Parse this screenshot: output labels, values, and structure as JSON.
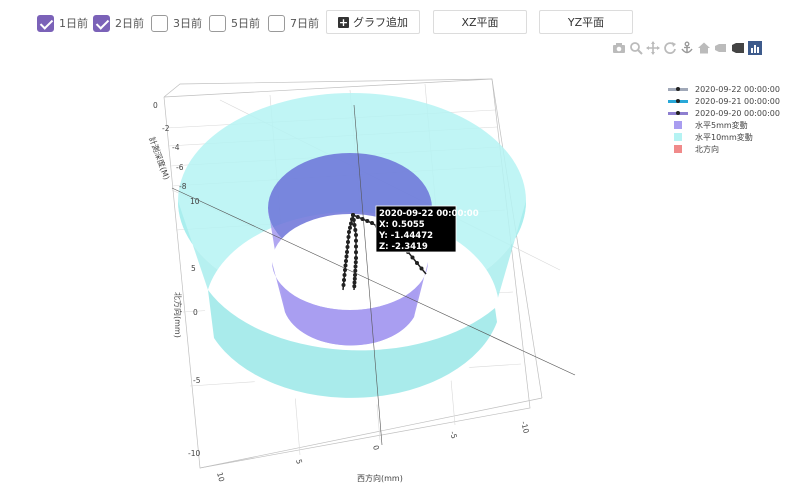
{
  "controls": {
    "checkboxes": [
      {
        "label": "1日前",
        "checked": true
      },
      {
        "label": "2日前",
        "checked": true
      },
      {
        "label": "3日前",
        "checked": false
      },
      {
        "label": "5日前",
        "checked": false
      },
      {
        "label": "7日前",
        "checked": false
      }
    ],
    "add_graph_label": "グラフ追加",
    "xz_plane_label": "XZ平面",
    "yz_plane_label": "YZ平面"
  },
  "modebar_icons": [
    "camera-icon",
    "zoom-icon",
    "pan-icon",
    "orbit-rotation-icon",
    "turntable-rotation-icon",
    "home-icon",
    "hover-closest-icon",
    "toggle-spike-lines-icon",
    "plotly-logo-icon"
  ],
  "legend": [
    {
      "label": "2020-09-22 00:00:00",
      "kind": "line",
      "color": "#a0a8b8"
    },
    {
      "label": "2020-09-21 00:00:00",
      "kind": "line",
      "color": "#29a8d8"
    },
    {
      "label": "2020-09-20 00:00:00",
      "kind": "line",
      "color": "#8e7fd0"
    },
    {
      "label": "水平5mm変動",
      "kind": "square",
      "color": "#a99df0"
    },
    {
      "label": "水平10mm変動",
      "kind": "square",
      "color": "#b5f3f3"
    },
    {
      "label": "北方向",
      "kind": "square",
      "color": "#f08a8a"
    }
  ],
  "tooltip": {
    "title": "2020-09-22 00:00:00",
    "x": "X: 0.5055",
    "y": "Y: -1.44472",
    "z": "Z: -2.3419"
  },
  "chart_data": {
    "type": "scatter3d",
    "axes": {
      "x": {
        "title": "西方向(mm)",
        "ticks": [
          "10",
          "5",
          "0",
          "-5",
          "-10"
        ],
        "range": [
          10,
          -10
        ]
      },
      "y": {
        "title": "北方向(mm)",
        "ticks": [
          "10",
          "5",
          "0",
          "-5",
          "-10"
        ],
        "range": [
          10,
          -10
        ]
      },
      "z": {
        "title": "計測深度(M)",
        "ticks": [
          "0",
          "-2",
          "-4",
          "-6",
          "-8"
        ],
        "range": [
          0,
          -8
        ]
      }
    },
    "series": [
      {
        "name": "2020-09-22 00:00:00",
        "mode": "lines+markers",
        "color": "#222222",
        "points": [
          {
            "x": 0.5055,
            "y": -1.44472,
            "z": -2.3419
          }
        ]
      },
      {
        "name": "水平5mm変動",
        "type": "cylinder",
        "radius": 5,
        "color": "#a99df0"
      },
      {
        "name": "水平10mm変動",
        "type": "cylinder",
        "radius": 10,
        "color": "#b5f3f3"
      }
    ],
    "legend_position": "top-right",
    "grid": true
  }
}
